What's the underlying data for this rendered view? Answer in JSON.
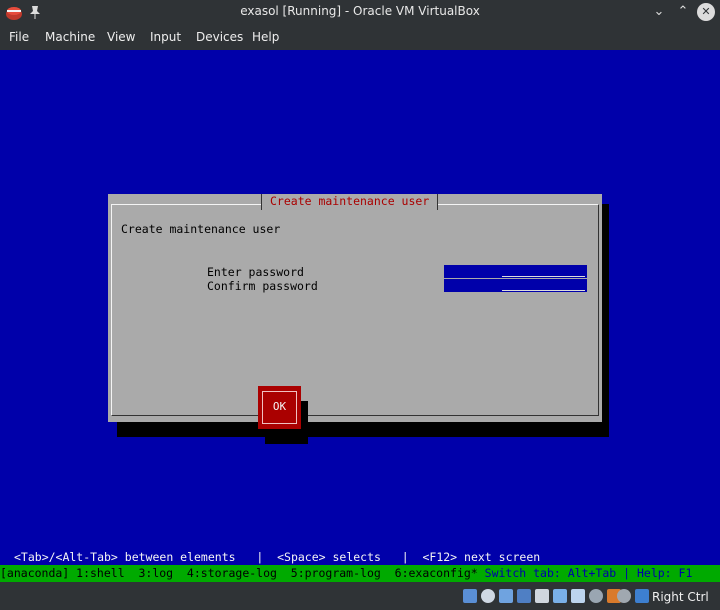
{
  "window": {
    "title": "exasol [Running] - Oracle VM VirtualBox",
    "minimize_glyph": "⌄",
    "maximize_glyph": "⌃",
    "close_glyph": "✕"
  },
  "menu": {
    "items": [
      "File",
      "Machine",
      "View",
      "Input",
      "Devices",
      "Help"
    ]
  },
  "dialog": {
    "title": "Create maintenance user",
    "heading": "Create maintenance user",
    "enter_label": "Enter password",
    "confirm_label": "Confirm password",
    "enter_value": "*********",
    "confirm_value": "*********",
    "ok_label": "OK"
  },
  "help_line": "<Tab>/<Alt-Tab> between elements   |  <Space> selects   |  <F12> next screen",
  "tmux": {
    "tabs": "[anaconda] 1:shell  3:log  4:storage-log  5:program-log  6:exaconfig*",
    "hint": " Switch tab: Alt+Tab | Help: F1"
  },
  "statusbar": {
    "host_key": "Right Ctrl",
    "icons": [
      "hard-disk-icon",
      "optical-drive-icon",
      "audio-icon",
      "network-icon",
      "usb-icon",
      "shared-folders-icon",
      "display-icon",
      "recording-icon",
      "cpu-icon",
      "mouse-integration-icon",
      "keyboard-icon"
    ]
  },
  "colors": {
    "vm_background": "#0000aa",
    "dialog_background": "#aaaaaa",
    "dialog_title": "#aa0000",
    "ok_button": "#aa0000",
    "tmux_bar": "#00aa00"
  }
}
